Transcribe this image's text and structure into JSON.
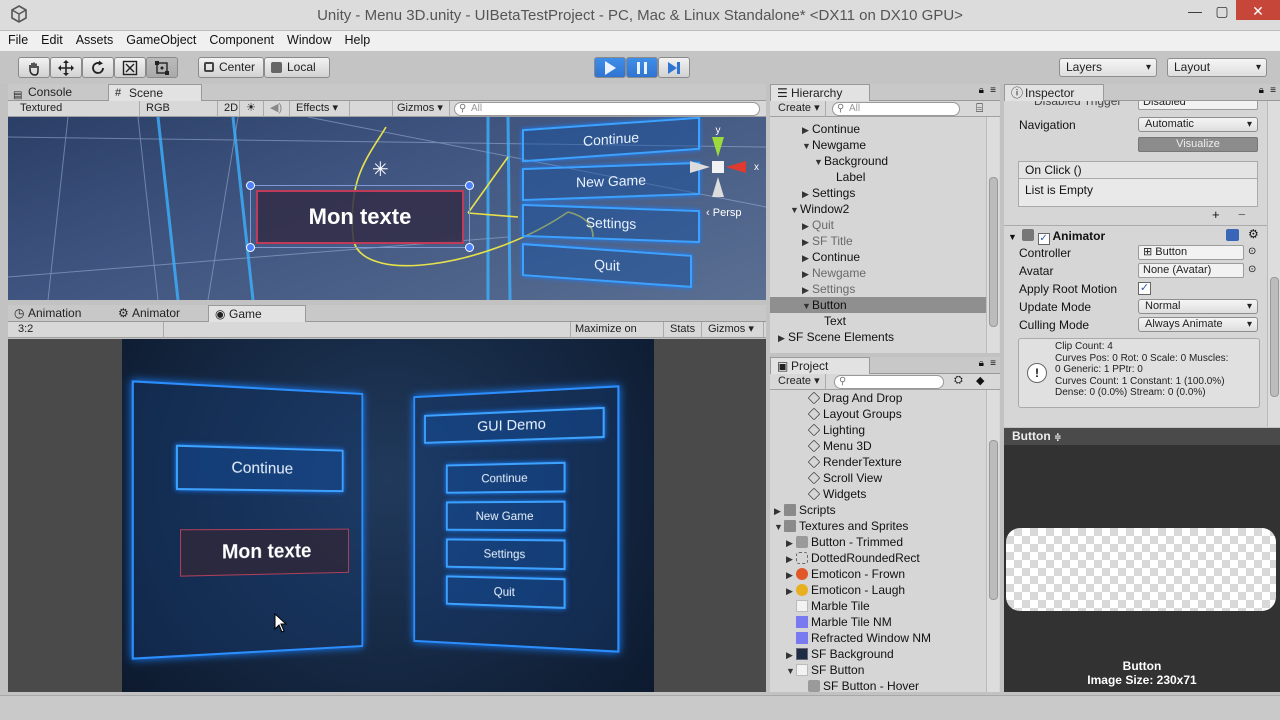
{
  "window": {
    "title": "Unity - Menu 3D.unity - UIBetaTestProject - PC, Mac & Linux Standalone* <DX11 on DX10 GPU>",
    "minimize": "—",
    "maximize": "▢",
    "close": "✕"
  },
  "menu": [
    "File",
    "Edit",
    "Assets",
    "GameObject",
    "Component",
    "Window",
    "Help"
  ],
  "toolbar": {
    "center": "Center",
    "local": "Local",
    "layers": "Layers",
    "layout": "Layout"
  },
  "scene": {
    "tabs": [
      "Console",
      "Scene"
    ],
    "render_mode": "Textured",
    "color_mode": "RGB",
    "mode_2d": "2D",
    "effects": "Effects",
    "gizmos": "Gizmos",
    "search": "All",
    "selected_text": "Mon texte",
    "buttons": [
      "Continue",
      "New Game",
      "Settings",
      "Quit"
    ],
    "persp": "Persp",
    "axis_x": "x",
    "axis_y": "y"
  },
  "game": {
    "tabs": [
      "Animation",
      "Animator",
      "Game"
    ],
    "aspect": "3:2",
    "maximize": "Maximize on Play",
    "stats": "Stats",
    "gizmos": "Gizmos",
    "left_panel": {
      "continue": "Continue",
      "selected": "Mon texte"
    },
    "right_panel": {
      "title": "GUI Demo",
      "items": [
        "Continue",
        "New Game",
        "Settings",
        "Quit"
      ]
    }
  },
  "hierarchy": {
    "tab": "Hierarchy",
    "create": "Create",
    "search": "All",
    "rows": [
      {
        "label": "Continue",
        "indent": 3,
        "arrow": "▶",
        "dim": false
      },
      {
        "label": "Newgame",
        "indent": 3,
        "arrow": "▼",
        "dim": false
      },
      {
        "label": "Background",
        "indent": 4,
        "arrow": "▼",
        "dim": false
      },
      {
        "label": "Label",
        "indent": 5,
        "arrow": "",
        "dim": false
      },
      {
        "label": "Settings",
        "indent": 3,
        "arrow": "▶",
        "dim": false
      },
      {
        "label": "Window2",
        "indent": 2,
        "arrow": "▼",
        "dim": false
      },
      {
        "label": "Quit",
        "indent": 3,
        "arrow": "▶",
        "dim": true
      },
      {
        "label": "SF Title",
        "indent": 3,
        "arrow": "▶",
        "dim": true
      },
      {
        "label": "Continue",
        "indent": 3,
        "arrow": "▶",
        "dim": false
      },
      {
        "label": "Newgame",
        "indent": 3,
        "arrow": "▶",
        "dim": true
      },
      {
        "label": "Settings",
        "indent": 3,
        "arrow": "▶",
        "dim": true
      },
      {
        "label": "Button",
        "indent": 3,
        "arrow": "▼",
        "dim": false,
        "selected": true
      },
      {
        "label": "Text",
        "indent": 4,
        "arrow": "",
        "dim": false
      },
      {
        "label": "SF Scene Elements",
        "indent": 1,
        "arrow": "▶",
        "dim": false
      }
    ]
  },
  "project": {
    "tab": "Project",
    "create": "Create",
    "rows": [
      {
        "label": "Drag And Drop",
        "icon": "unity",
        "indent": 3
      },
      {
        "label": "Layout Groups",
        "icon": "unity",
        "indent": 3
      },
      {
        "label": "Lighting",
        "icon": "unity",
        "indent": 3
      },
      {
        "label": "Menu 3D",
        "icon": "unity",
        "indent": 3
      },
      {
        "label": "RenderTexture",
        "icon": "unity",
        "indent": 3
      },
      {
        "label": "Scroll View",
        "icon": "unity",
        "indent": 3
      },
      {
        "label": "Widgets",
        "icon": "unity",
        "indent": 3
      },
      {
        "label": "Scripts",
        "icon": "folder",
        "indent": 1,
        "arrow": "▶"
      },
      {
        "label": "Textures and Sprites",
        "icon": "folder",
        "indent": 1,
        "arrow": "▼"
      },
      {
        "label": "Button - Trimmed",
        "icon": "grey",
        "indent": 2,
        "arrow": "▶"
      },
      {
        "label": "DottedRoundedRect",
        "icon": "dotted",
        "indent": 2,
        "arrow": "▶"
      },
      {
        "label": "Emoticon - Frown",
        "icon": "frown",
        "indent": 2,
        "arrow": "▶"
      },
      {
        "label": "Emoticon - Laugh",
        "icon": "laugh",
        "indent": 2,
        "arrow": "▶"
      },
      {
        "label": "Marble Tile",
        "icon": "white",
        "indent": 2
      },
      {
        "label": "Marble Tile NM",
        "icon": "purple",
        "indent": 2
      },
      {
        "label": "Refracted Window NM",
        "icon": "purple",
        "indent": 2
      },
      {
        "label": "SF Background",
        "icon": "dark",
        "indent": 2,
        "arrow": "▶"
      },
      {
        "label": "SF Button",
        "icon": "white",
        "indent": 2,
        "arrow": "▼"
      },
      {
        "label": "SF Button - Hover",
        "icon": "grey",
        "indent": 3
      }
    ]
  },
  "inspector": {
    "tab": "Inspector",
    "disabled_trigger": "Disabled Trigger",
    "disabled_value": "Disabled",
    "navigation_label": "Navigation",
    "navigation_value": "Automatic",
    "visualize": "Visualize",
    "onclick": "On Click ()",
    "list_empty": "List is Empty",
    "plus": "+",
    "minus": "−",
    "animator": {
      "title": "Animator",
      "controller_label": "Controller",
      "controller_value": "Button",
      "avatar_label": "Avatar",
      "avatar_value": "None (Avatar)",
      "root_motion_label": "Apply Root Motion",
      "update_label": "Update Mode",
      "update_value": "Normal",
      "culling_label": "Culling Mode",
      "culling_value": "Always Animate"
    },
    "info": [
      "Clip Count: 4",
      "Curves Pos: 0 Rot: 0 Scale: 0 Muscles:",
      "0 Generic: 1 PPtr: 0",
      "Curves Count: 1 Constant: 1 (100.0%)",
      "Dense: 0 (0.0%) Stream: 0 (0.0%)"
    ],
    "preview_title": "Button",
    "preview_caption": "Button",
    "preview_size": "Image Size: 230x71"
  },
  "colors": {
    "play_active": "#2f74d0",
    "selection": "#8f8f8f",
    "ui_glow": "#2b8fff"
  }
}
